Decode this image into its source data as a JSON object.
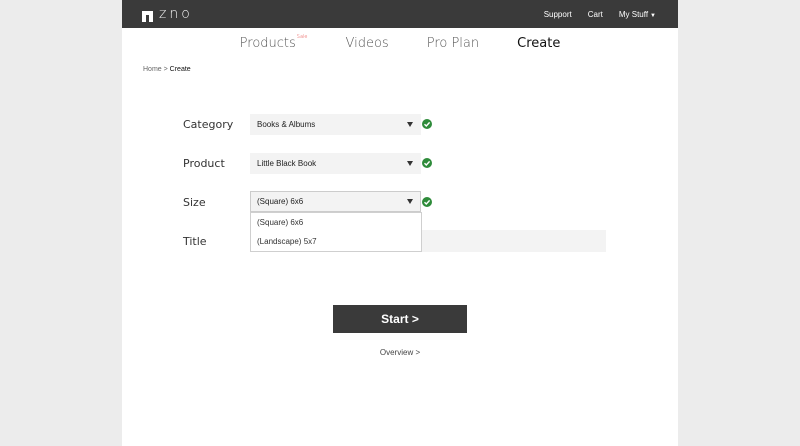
{
  "header": {
    "logo_text": "ZNO",
    "links": {
      "support": "Support",
      "cart": "Cart",
      "my_stuff": "My Stuff"
    }
  },
  "nav": {
    "items": [
      {
        "label": "Products",
        "badge": "Sale"
      },
      {
        "label": "Videos"
      },
      {
        "label": "Pro Plan"
      },
      {
        "label": "Create",
        "active": true
      }
    ]
  },
  "breadcrumb": {
    "home": "Home",
    "separator": " > ",
    "current": "Create"
  },
  "form": {
    "category": {
      "label": "Category",
      "value": "Books & Albums"
    },
    "product": {
      "label": "Product",
      "value": "Little Black Book"
    },
    "size": {
      "label": "Size",
      "value": "(Square) 6x6",
      "options": [
        "(Square) 6x6",
        "(Landscape) 5x7"
      ]
    },
    "title": {
      "label": "Title",
      "value": "",
      "placeholder": ""
    }
  },
  "actions": {
    "start": "Start >",
    "overview": "Overview >"
  },
  "colors": {
    "topbar": "#3a3a3a",
    "check": "#2e8b3a",
    "sale": "#e53935",
    "button": "#3a3a3a"
  }
}
